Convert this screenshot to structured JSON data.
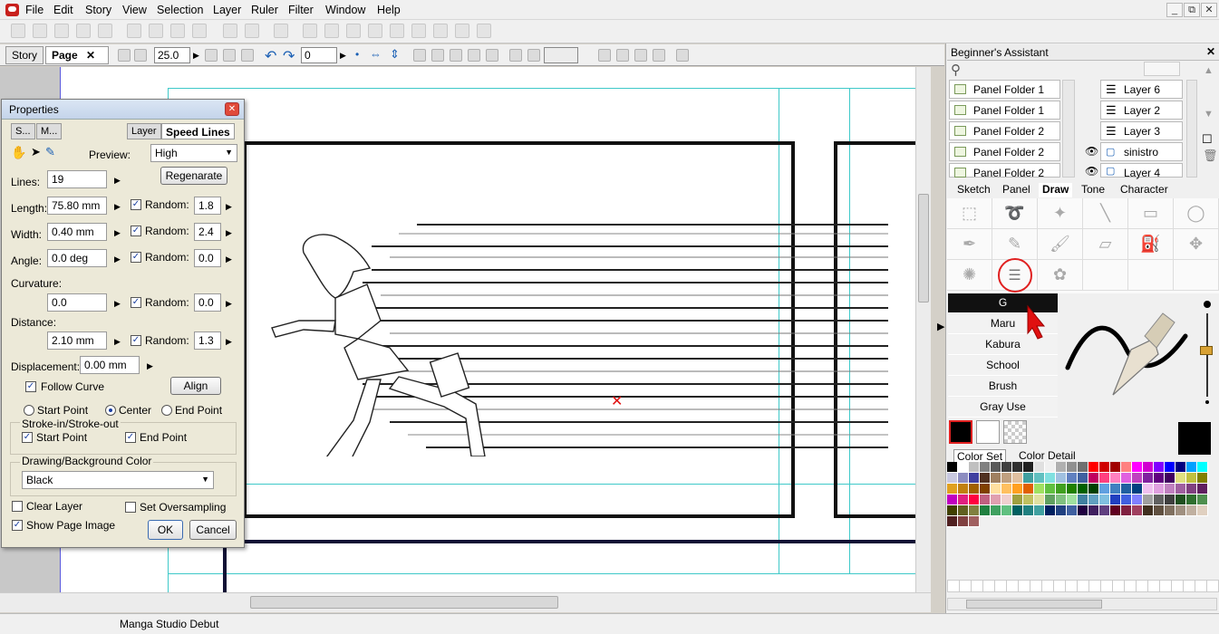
{
  "menu": [
    "File",
    "Edit",
    "Story",
    "View",
    "Selection",
    "Layer",
    "Ruler",
    "Filter",
    "Window",
    "Help"
  ],
  "window_controls": [
    "_",
    "⧉",
    "✕"
  ],
  "doc_tabs": {
    "story": "Story",
    "page": "Page",
    "close": "✕"
  },
  "toolbar2": {
    "zoom": "25.0",
    "rotate": "0"
  },
  "properties": {
    "title": "Properties",
    "tabs": [
      "S...",
      "M...",
      "Layer",
      "Speed Lines"
    ],
    "preview_label": "Preview:",
    "preview_value": "High",
    "lines_label": "Lines:",
    "lines_value": "19",
    "regenerate": "Regenarate",
    "length_label": "Length:",
    "length_value": "75.80 mm",
    "width_label": "Width:",
    "width_value": "0.40 mm",
    "angle_label": "Angle:",
    "angle_value": "0.0 deg",
    "curvature_label": "Curvature:",
    "curvature_value": "0.0",
    "distance_label": "Distance:",
    "distance_value": "2.10 mm",
    "random_label": "Random:",
    "random_length": "1.8",
    "random_width": "2.4",
    "random_angle": "0.0",
    "random_curvature": "0.0",
    "random_distance": "1.3",
    "displacement_label": "Displacement:",
    "displacement_value": "0.00 mm",
    "follow_curve": "Follow Curve",
    "align": "Align",
    "start_point": "Start Point",
    "center": "Center",
    "end_point": "End Point",
    "stroke_group": "Stroke-in/Stroke-out",
    "color_group": "Drawing/Background Color",
    "color_value": "Black",
    "clear_layer": "Clear Layer",
    "set_oversampling": "Set Oversampling",
    "show_page_image": "Show Page Image",
    "ok": "OK",
    "cancel": "Cancel"
  },
  "assistant": {
    "title": "Beginner's Assistant",
    "close": "✕",
    "folders": [
      "Panel Folder 1",
      "Panel Folder 1",
      "Panel Folder 2",
      "Panel Folder 2",
      "Panel Folder 2"
    ],
    "layers": [
      "Layer 6",
      "Layer 2",
      "Layer 3",
      "sinistro",
      "Layer 4"
    ],
    "tabs": [
      "Sketch",
      "Panel",
      "Draw",
      "Tone",
      "Character"
    ],
    "active_tab": "Draw",
    "brushes": [
      "G",
      "Maru",
      "Kabura",
      "School",
      "Brush",
      "Gray Use"
    ],
    "color_tabs": [
      "Color Set",
      "Color Detail"
    ]
  },
  "status": {
    "app_name": "Manga Studio Debut"
  },
  "colors": {
    "palette_row1": [
      "#000000",
      "#ffffff",
      "#c0c0c0",
      "#808080",
      "#5a5a5a",
      "#404040",
      "#303030",
      "#202020",
      "#e0e0e0",
      "#f0f0f0",
      "#b0b0b0",
      "#909090",
      "#707070",
      "#ff0000",
      "#d00000",
      "#a00000",
      "#ff8080",
      "#ff00ff",
      "#d000d0",
      "#8000ff",
      "#0000ff",
      "#000080",
      "#00a0ff",
      "#00ffff"
    ]
  }
}
